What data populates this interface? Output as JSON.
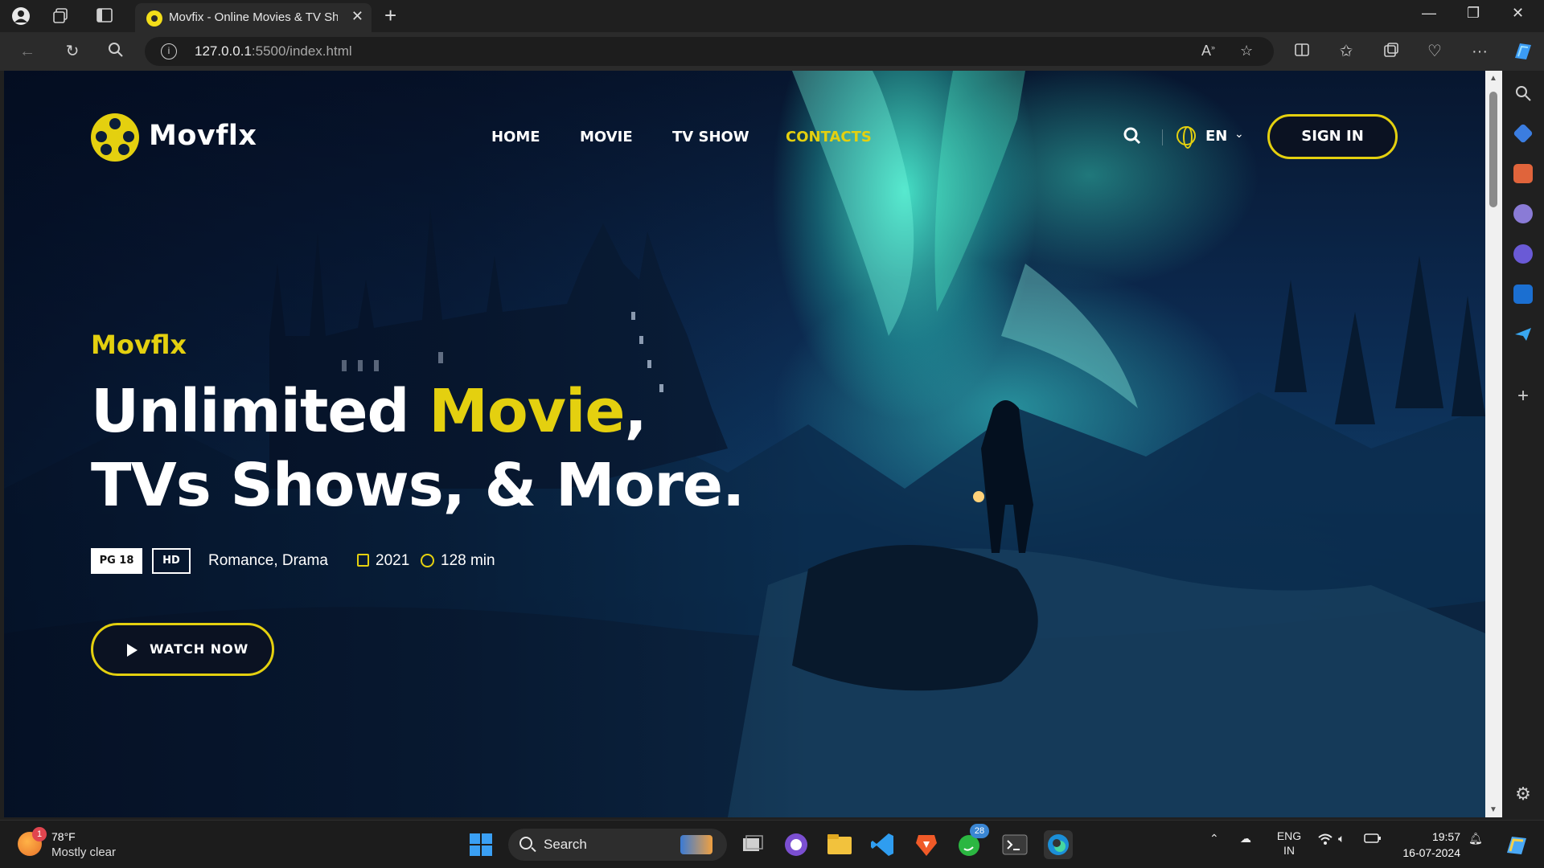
{
  "browser": {
    "tab_title": "Movfix - Online Movies & TV Shows",
    "url_host": "127.0.0.1",
    "url_path": ":5500/index.html"
  },
  "site": {
    "logo_text": "Movflx",
    "nav": [
      {
        "label": "HOME"
      },
      {
        "label": "MOVIE"
      },
      {
        "label": "TV SHOW"
      },
      {
        "label": "CONTACTS",
        "active": true
      }
    ],
    "language": "EN",
    "signin_label": "SIGN IN"
  },
  "hero": {
    "subtitle": "Movflx",
    "headline_part1": "Unlimited ",
    "headline_highlight": "Movie",
    "headline_part2": ",",
    "headline_line2": "TVs Shows, & More.",
    "rating_badge": "PG 18",
    "quality_badge": "HD",
    "genres": "Romance, Drama",
    "year": "2021",
    "duration": "128 min",
    "cta_label": "WATCH NOW"
  },
  "taskbar": {
    "weather_temp": "78°F",
    "weather_condition": "Mostly clear",
    "weather_badge": "1",
    "search_label": "Search",
    "whatsapp_badge": "28",
    "lang_line1": "ENG",
    "lang_line2": "IN",
    "time": "19:57",
    "date": "16-07-2024"
  },
  "colors": {
    "accent": "#e4d00f",
    "hero_dark": "#07162f",
    "aurora": "#50ffdc"
  }
}
